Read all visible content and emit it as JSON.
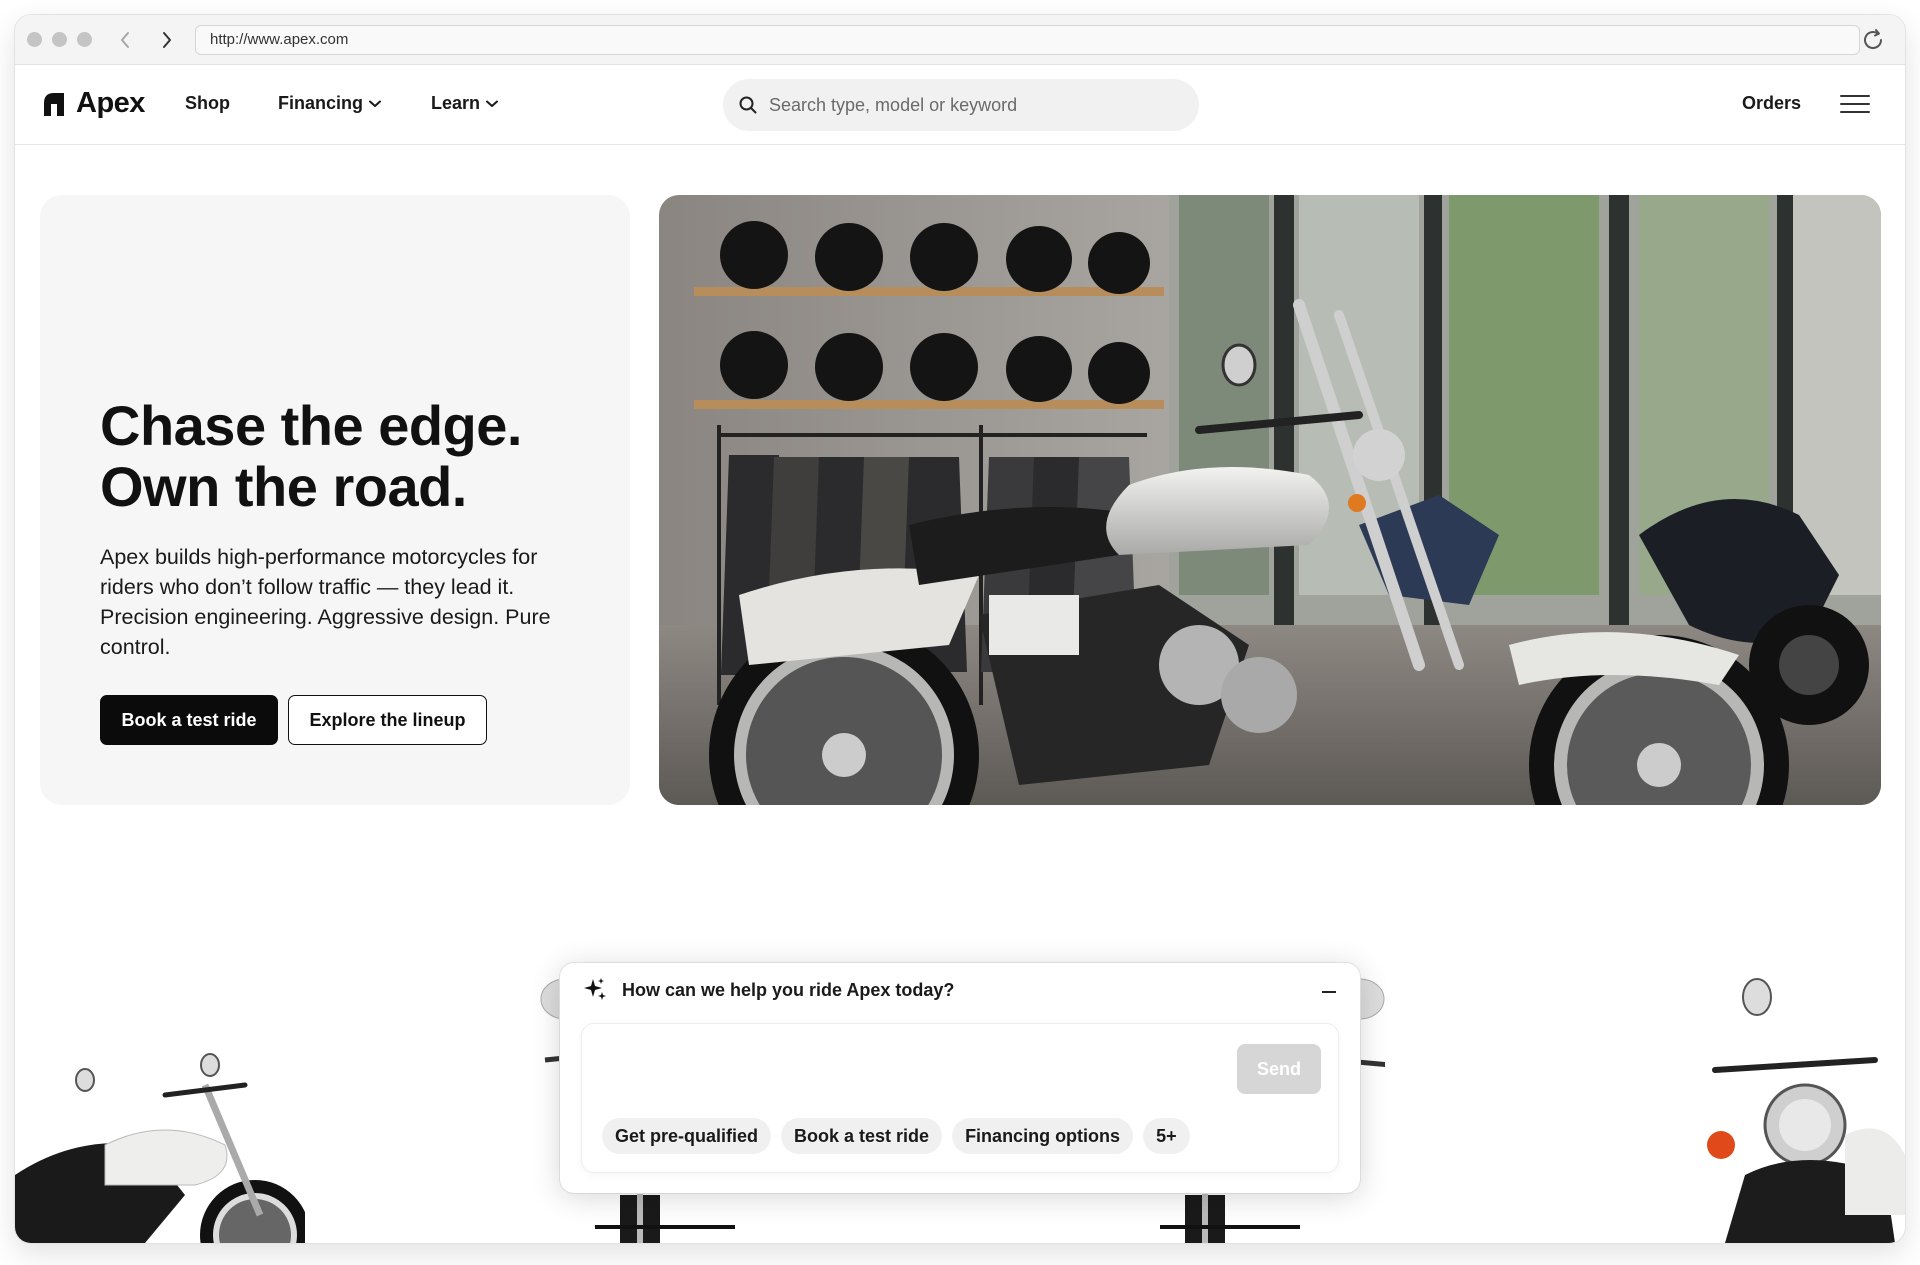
{
  "browser": {
    "url": "http://www.apex.com"
  },
  "nav": {
    "brand": "Apex",
    "links": [
      {
        "label": "Shop"
      },
      {
        "label": "Financing"
      },
      {
        "label": "Learn"
      }
    ],
    "search_placeholder": "Search type, model or keyword",
    "orders_label": "Orders"
  },
  "hero": {
    "title_line1": "Chase the edge.",
    "title_line2": "Own the road.",
    "description": "Apex builds high-performance motorcycles for riders who don’t follow traffic — they lead it. Precision engineering. Aggressive design. Pure control.",
    "primary_cta": "Book a test ride",
    "secondary_cta": "Explore the lineup"
  },
  "chat": {
    "heading": "How can we help you ride Apex today?",
    "input_value": "",
    "send_label": "Send",
    "suggestions": [
      {
        "label": "Get pre-qualified"
      },
      {
        "label": "Book a test ride"
      },
      {
        "label": "Financing options"
      },
      {
        "label": "5+"
      }
    ]
  },
  "colors": {
    "primary_button": "#0b0b0b",
    "hero_card_bg": "#f6f6f6",
    "chip_bg": "#f0f0f0",
    "send_disabled": "#d6d6d6"
  },
  "icons": {
    "search": "search-icon",
    "sparkle": "sparkle-icon",
    "menu": "hamburger-menu-icon",
    "chevron": "chevron-down-icon"
  }
}
